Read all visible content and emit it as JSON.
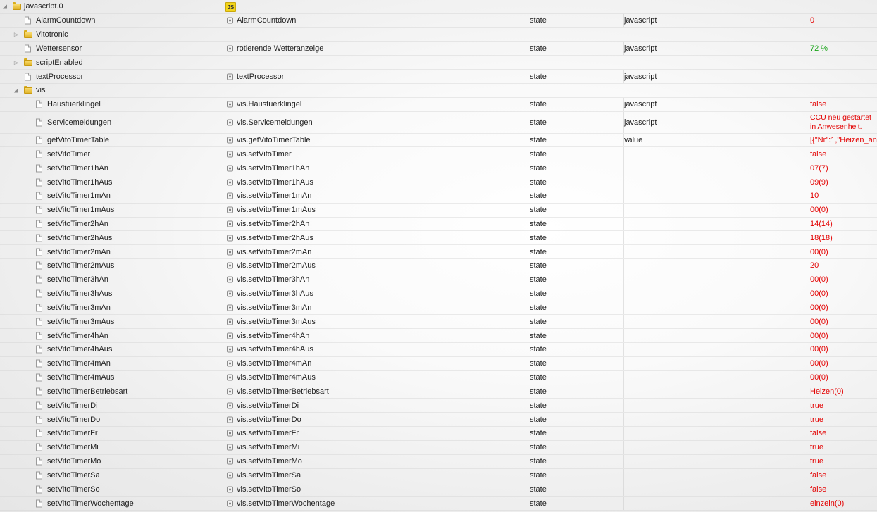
{
  "adapter": {
    "name": "javascript.0",
    "icon": "js-icon",
    "icon_label": "JS"
  },
  "rows": [
    {
      "name": "AlarmCountdown",
      "kind": "file",
      "level": 1,
      "obj": "AlarmCountdown",
      "type": "state",
      "role": "javascript",
      "value": "0"
    },
    {
      "name": "Vitotronic",
      "kind": "folder",
      "expanded": false,
      "level": 1
    },
    {
      "name": "Wettersensor",
      "kind": "file",
      "level": 1,
      "obj": "rotierende Wetteranzeige",
      "type": "state",
      "role": "javascript",
      "value": "72 %",
      "value_color": "green"
    },
    {
      "name": "scriptEnabled",
      "kind": "folder",
      "expanded": false,
      "level": 1
    },
    {
      "name": "textProcessor",
      "kind": "file",
      "level": 1,
      "obj": "textProcessor",
      "type": "state",
      "role": "javascript",
      "value": ""
    },
    {
      "name": "vis",
      "kind": "folder",
      "expanded": true,
      "level": 1
    },
    {
      "name": "Haustuerklingel",
      "kind": "file",
      "level": 2,
      "obj": "vis.Haustuerklingel",
      "type": "state",
      "role": "javascript",
      "value": "false"
    },
    {
      "name": "Servicemeldungen",
      "kind": "file",
      "level": 2,
      "obj": "vis.Servicemeldungen",
      "type": "state",
      "role": "javascript",
      "value": "CCU neu gestartet",
      "value2": "in Anwesenheit.",
      "tall": true
    },
    {
      "name": "getVitoTimerTable",
      "kind": "file",
      "level": 2,
      "obj": "vis.getVitoTimerTable",
      "type": "state",
      "role": "value",
      "value": "[{\"Nr\":1,\"Heizen_an\""
    },
    {
      "name": "setVitoTimer",
      "kind": "file",
      "level": 2,
      "obj": "vis.setVitoTimer",
      "type": "state",
      "role": "",
      "value": "false"
    },
    {
      "name": "setVitoTimer1hAn",
      "kind": "file",
      "level": 2,
      "obj": "vis.setVitoTimer1hAn",
      "type": "state",
      "role": "",
      "value": "07(7)"
    },
    {
      "name": "setVitoTimer1hAus",
      "kind": "file",
      "level": 2,
      "obj": "vis.setVitoTimer1hAus",
      "type": "state",
      "role": "",
      "value": "09(9)"
    },
    {
      "name": "setVitoTimer1mAn",
      "kind": "file",
      "level": 2,
      "obj": "vis.setVitoTimer1mAn",
      "type": "state",
      "role": "",
      "value": "10"
    },
    {
      "name": "setVitoTimer1mAus",
      "kind": "file",
      "level": 2,
      "obj": "vis.setVitoTimer1mAus",
      "type": "state",
      "role": "",
      "value": "00(0)"
    },
    {
      "name": "setVitoTimer2hAn",
      "kind": "file",
      "level": 2,
      "obj": "vis.setVitoTimer2hAn",
      "type": "state",
      "role": "",
      "value": "14(14)"
    },
    {
      "name": "setVitoTimer2hAus",
      "kind": "file",
      "level": 2,
      "obj": "vis.setVitoTimer2hAus",
      "type": "state",
      "role": "",
      "value": "18(18)"
    },
    {
      "name": "setVitoTimer2mAn",
      "kind": "file",
      "level": 2,
      "obj": "vis.setVitoTimer2mAn",
      "type": "state",
      "role": "",
      "value": "00(0)"
    },
    {
      "name": "setVitoTimer2mAus",
      "kind": "file",
      "level": 2,
      "obj": "vis.setVitoTimer2mAus",
      "type": "state",
      "role": "",
      "value": "20"
    },
    {
      "name": "setVitoTimer3hAn",
      "kind": "file",
      "level": 2,
      "obj": "vis.setVitoTimer3hAn",
      "type": "state",
      "role": "",
      "value": "00(0)"
    },
    {
      "name": "setVitoTimer3hAus",
      "kind": "file",
      "level": 2,
      "obj": "vis.setVitoTimer3hAus",
      "type": "state",
      "role": "",
      "value": "00(0)"
    },
    {
      "name": "setVitoTimer3mAn",
      "kind": "file",
      "level": 2,
      "obj": "vis.setVitoTimer3mAn",
      "type": "state",
      "role": "",
      "value": "00(0)"
    },
    {
      "name": "setVitoTimer3mAus",
      "kind": "file",
      "level": 2,
      "obj": "vis.setVitoTimer3mAus",
      "type": "state",
      "role": "",
      "value": "00(0)"
    },
    {
      "name": "setVitoTimer4hAn",
      "kind": "file",
      "level": 2,
      "obj": "vis.setVitoTimer4hAn",
      "type": "state",
      "role": "",
      "value": "00(0)"
    },
    {
      "name": "setVitoTimer4hAus",
      "kind": "file",
      "level": 2,
      "obj": "vis.setVitoTimer4hAus",
      "type": "state",
      "role": "",
      "value": "00(0)"
    },
    {
      "name": "setVitoTimer4mAn",
      "kind": "file",
      "level": 2,
      "obj": "vis.setVitoTimer4mAn",
      "type": "state",
      "role": "",
      "value": "00(0)"
    },
    {
      "name": "setVitoTimer4mAus",
      "kind": "file",
      "level": 2,
      "obj": "vis.setVitoTimer4mAus",
      "type": "state",
      "role": "",
      "value": "00(0)"
    },
    {
      "name": "setVitoTimerBetriebsart",
      "kind": "file",
      "level": 2,
      "obj": "vis.setVitoTimerBetriebsart",
      "type": "state",
      "role": "",
      "value": "Heizen(0)"
    },
    {
      "name": "setVitoTimerDi",
      "kind": "file",
      "level": 2,
      "obj": "vis.setVitoTimerDi",
      "type": "state",
      "role": "",
      "value": "true"
    },
    {
      "name": "setVitoTimerDo",
      "kind": "file",
      "level": 2,
      "obj": "vis.setVitoTimerDo",
      "type": "state",
      "role": "",
      "value": "true"
    },
    {
      "name": "setVitoTimerFr",
      "kind": "file",
      "level": 2,
      "obj": "vis.setVitoTimerFr",
      "type": "state",
      "role": "",
      "value": "false"
    },
    {
      "name": "setVitoTimerMi",
      "kind": "file",
      "level": 2,
      "obj": "vis.setVitoTimerMi",
      "type": "state",
      "role": "",
      "value": "true"
    },
    {
      "name": "setVitoTimerMo",
      "kind": "file",
      "level": 2,
      "obj": "vis.setVitoTimerMo",
      "type": "state",
      "role": "",
      "value": "true"
    },
    {
      "name": "setVitoTimerSa",
      "kind": "file",
      "level": 2,
      "obj": "vis.setVitoTimerSa",
      "type": "state",
      "role": "",
      "value": "false"
    },
    {
      "name": "setVitoTimerSo",
      "kind": "file",
      "level": 2,
      "obj": "vis.setVitoTimerSo",
      "type": "state",
      "role": "",
      "value": "false"
    },
    {
      "name": "setVitoTimerWochentage",
      "kind": "file",
      "level": 2,
      "obj": "vis.setVitoTimerWochentage",
      "type": "state",
      "role": "",
      "value": "einzeln(0)"
    }
  ],
  "colors": {
    "value_default": "#e30000",
    "value_green": "#1aa51a",
    "folder": "#f0c93c",
    "js_icon": "#f2d41a"
  }
}
